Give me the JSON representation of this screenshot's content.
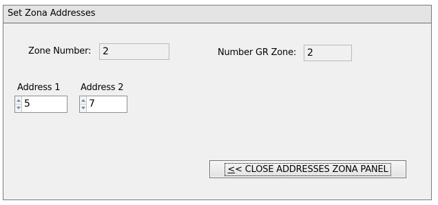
{
  "panel": {
    "title": "Set Zona Addresses"
  },
  "zone_number": {
    "label": "Zone Number:",
    "value": "2"
  },
  "number_gr_zone": {
    "label": "Number GR Zone:",
    "value": "2"
  },
  "address_1": {
    "label": "Address 1",
    "value": "5"
  },
  "address_2": {
    "label": "Address 2",
    "value": "7"
  },
  "close_button": {
    "mnemonic": "<",
    "label_rest": "< CLOSE ADDRESSES ZONA PANEL"
  },
  "icons": {
    "spin_up": "arrow-up-icon",
    "spin_down": "arrow-down-icon"
  },
  "colors": {
    "panel_background": "#f0f0f0",
    "title_background": "#e4e4e4",
    "spin_arrow": "#6d8fb6"
  }
}
